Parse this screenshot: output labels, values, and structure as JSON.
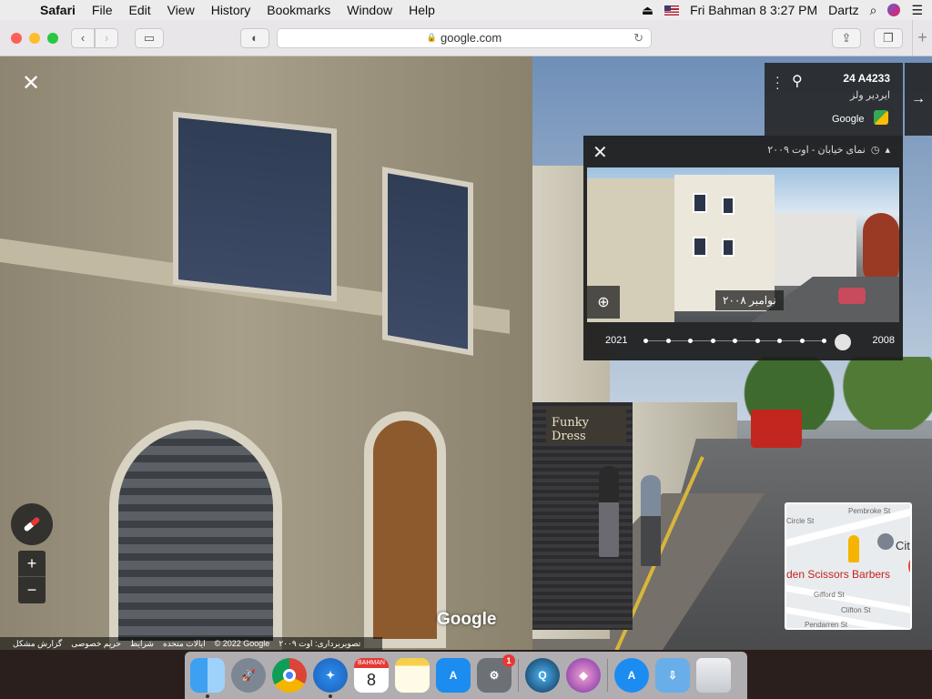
{
  "menubar": {
    "app_name": "Safari",
    "items": [
      "File",
      "Edit",
      "View",
      "History",
      "Bookmarks",
      "Window",
      "Help"
    ],
    "datetime": "Fri Bahman 8  3:27 PM",
    "user": "Dartz"
  },
  "toolbar": {
    "url": "google.com",
    "icons": [
      "back-icon",
      "forward-icon",
      "sidebar-icon",
      "shield-icon",
      "lock-icon",
      "reload-icon",
      "share-icon",
      "tabs-icon",
      "plus-icon"
    ]
  },
  "place_card": {
    "title": "24 A4233",
    "subtitle": "ایردیر ولز",
    "brand": "Google"
  },
  "time_machine": {
    "header": "نمای خیابان - اوت ۲۰۰۹",
    "photo_label": "نوامبر ۲۰۰۸",
    "year_start": "2021",
    "year_end": "2008",
    "timeline_stops": 9,
    "selected_index": 9
  },
  "scene": {
    "shop_sign": "Funky Dress",
    "google_logo": "Google"
  },
  "minimap": {
    "poi": "den Scissors Barbers",
    "streets": [
      "Pembroke St",
      "Gifford St",
      "Clifton St",
      "Pendarren St",
      "Circle St"
    ],
    "city_label": "Cit"
  },
  "footer": {
    "items": [
      "گزارش مشکل",
      "حریم خصوصی",
      "شرایط",
      "ایالات متحده",
      "© 2022 Google",
      "تصویربرداری: اوت ۲۰۰۹"
    ]
  },
  "dock": {
    "calendar_month": "BAHMAN",
    "calendar_day": "8",
    "badge_count": "1"
  }
}
